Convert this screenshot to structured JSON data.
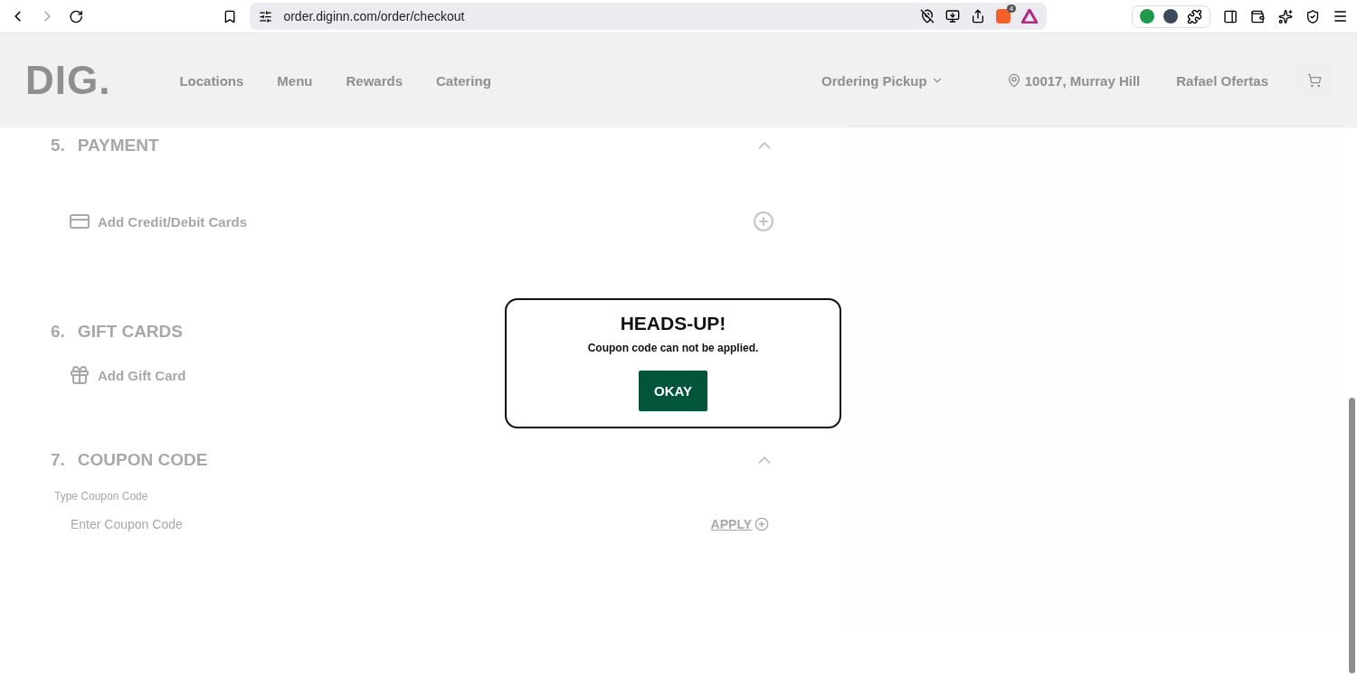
{
  "browser": {
    "url": "order.diginn.com/order/checkout",
    "shields_count": "4"
  },
  "header": {
    "logo": "DIG.",
    "nav": [
      "Locations",
      "Menu",
      "Rewards",
      "Catering"
    ],
    "ordering_mode": "Ordering Pickup",
    "location": "10017, Murray Hill",
    "user": "Rafael Ofertas"
  },
  "sections": [
    {
      "kind": "cards",
      "number": "5.",
      "title": "PAYMENT",
      "action": "Add Credit/Debit Cards"
    },
    {
      "kind": "gift",
      "number": "6.",
      "title": "GIFT CARDS",
      "action": "Add Gift Card"
    },
    {
      "kind": "coupon",
      "number": "7.",
      "title": "COUPON CODE",
      "label": "Type Coupon Code",
      "placeholder": "Enter Coupon Code",
      "button": "APPLY"
    }
  ],
  "dialog": {
    "title": "HEADS-UP!",
    "message": "Coupon code can not be applied.",
    "button": "OKAY"
  }
}
